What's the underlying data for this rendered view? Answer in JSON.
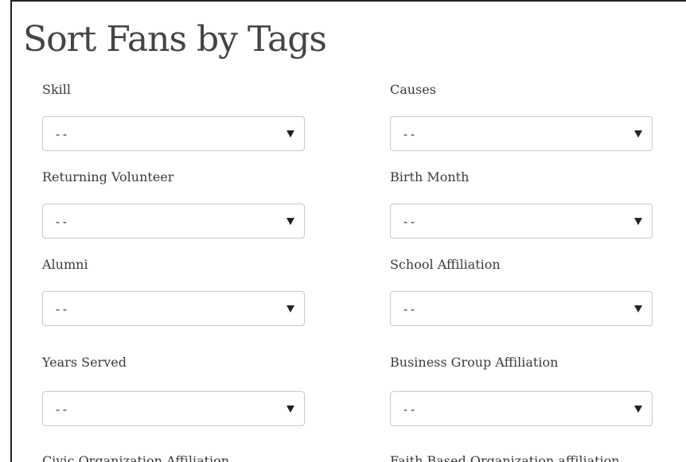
{
  "page": {
    "title": "Sort Fans by Tags"
  },
  "filters": [
    {
      "label": "Skill",
      "value": "--"
    },
    {
      "label": "Causes",
      "value": "--"
    },
    {
      "label": "Returning Volunteer",
      "value": "--"
    },
    {
      "label": "Birth Month",
      "value": "--"
    },
    {
      "label": "Alumni",
      "value": "--"
    },
    {
      "label": "School Affiliation",
      "value": "--"
    },
    {
      "label": "Years Served",
      "value": "--"
    },
    {
      "label": "Business Group Affiliation",
      "value": "--"
    },
    {
      "label": "Civic Organization Affiliation",
      "value": ""
    },
    {
      "label": "Faith Based Organization affiliation",
      "value": ""
    }
  ],
  "icons": {
    "dropdown": "chevron-down-icon"
  }
}
